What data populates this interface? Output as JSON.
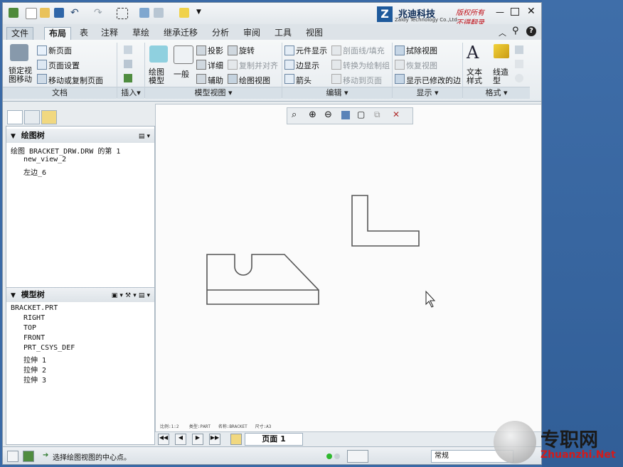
{
  "brand": {
    "name": "兆迪科技",
    "sub": "Zaldy Technology Co.,Ltd.",
    "note1": "版权所有",
    "note2": "不得翻录"
  },
  "tabs": [
    "文件",
    "布局",
    "表",
    "注释",
    "草绘",
    "继承迁移",
    "分析",
    "审阅",
    "工具",
    "视图"
  ],
  "active_tab": "布局",
  "ribbon": {
    "doc": {
      "lock": "锁定视\n图移动",
      "new_page": "新页面",
      "page_setup": "页面设置",
      "move_copy": "移动或复制页面",
      "group": "文档"
    },
    "insert": {
      "group": "插入"
    },
    "model_views": {
      "drawing_model": "绘图\n模型",
      "general": "一般",
      "projection": "投影",
      "detail": "详细",
      "auxiliary": "辅助",
      "revolve": "旋转",
      "copy_align": "复制并对齐",
      "drawing_view": "绘图视图",
      "group": "模型视图"
    },
    "edit": {
      "element_display": "元件显示",
      "edge_display": "边显示",
      "arrow": "箭头",
      "section_fill": "剖面线/填充",
      "convert_drawing": "转换为绘制组",
      "move_to_page": "移动到页面",
      "group": "编辑"
    },
    "display": {
      "erase_view": "拭除视图",
      "restore_view": "恢复视图",
      "show_modified_edges": "显示已修改的边",
      "group": "显示"
    },
    "format": {
      "text_style": "文本\n样式",
      "line_type": "线造\n型",
      "group": "格式"
    }
  },
  "drawing_tree": {
    "title": "绘图树",
    "root": "绘图 BRACKET_DRW.DRW 的第 1",
    "items": [
      "new_view_2",
      "左边_6"
    ]
  },
  "model_tree": {
    "title": "模型树",
    "root": "BRACKET.PRT",
    "items": [
      "RIGHT",
      "TOP",
      "FRONT",
      "PRT_CSYS_DEF",
      "拉伸 1",
      "拉伸 2",
      "拉伸 3"
    ]
  },
  "canvas_footer": {
    "scale": "比例:1:2",
    "type": "类型:PART",
    "name": "名称:BRACKET",
    "size": "尺寸:A3"
  },
  "pager": {
    "page_label": "页面 1"
  },
  "status": {
    "message": "选择绘图视图的中心点。",
    "filter": "常规"
  },
  "watermark": {
    "text": "专职网",
    "url": "Zhuanzhi.Net"
  },
  "colors": {
    "accent": "#1e5a9c",
    "brand_red": "#c0141c",
    "desktop": "#3a6aa6"
  }
}
